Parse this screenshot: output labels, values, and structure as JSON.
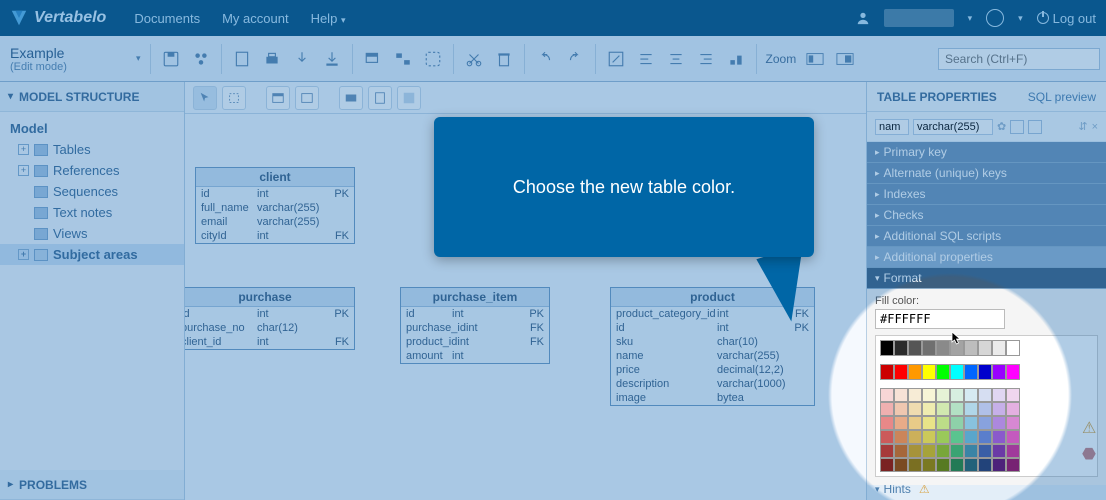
{
  "brand": "Vertabelo",
  "topnav": {
    "documents": "Documents",
    "my_account": "My account",
    "help": "Help",
    "logout": "Log out"
  },
  "doc": {
    "title": "Example",
    "mode": "(Edit mode)"
  },
  "zoom_label": "Zoom",
  "search_placeholder": "Search (Ctrl+F)",
  "leftpanel": {
    "structure_hdr": "MODEL STRUCTURE",
    "root": "Model",
    "items": [
      "Tables",
      "References",
      "Sequences",
      "Text notes",
      "Views",
      "Subject areas"
    ],
    "problems_hdr": "PROBLEMS"
  },
  "tables": {
    "client": {
      "name": "client",
      "cols": [
        {
          "n": "id",
          "t": "int",
          "k": "PK"
        },
        {
          "n": "full_name",
          "t": "varchar(255)",
          "k": ""
        },
        {
          "n": "email",
          "t": "varchar(255)",
          "k": ""
        },
        {
          "n": "cityId",
          "t": "int",
          "k": "FK"
        }
      ]
    },
    "purchase": {
      "name": "purchase",
      "cols": [
        {
          "n": "id",
          "t": "int",
          "k": "PK"
        },
        {
          "n": "purchase_no",
          "t": "char(12)",
          "k": ""
        },
        {
          "n": "client_id",
          "t": "int",
          "k": "FK"
        }
      ]
    },
    "purchase_item": {
      "name": "purchase_item",
      "cols": [
        {
          "n": "id",
          "t": "int",
          "k": "PK"
        },
        {
          "n": "purchase_id",
          "t": "int",
          "k": "FK"
        },
        {
          "n": "product_id",
          "t": "int",
          "k": "FK"
        },
        {
          "n": "amount",
          "t": "int",
          "k": ""
        }
      ]
    },
    "product": {
      "name": "product",
      "cols": [
        {
          "n": "product_category_id",
          "t": "int",
          "k": "FK"
        },
        {
          "n": "id",
          "t": "int",
          "k": "PK"
        },
        {
          "n": "sku",
          "t": "char(10)",
          "k": ""
        },
        {
          "n": "name",
          "t": "varchar(255)",
          "k": ""
        },
        {
          "n": "price",
          "t": "decimal(12,2)",
          "k": ""
        },
        {
          "n": "description",
          "t": "varchar(1000)",
          "k": ""
        },
        {
          "n": "image",
          "t": "bytea",
          "k": ""
        }
      ]
    }
  },
  "rightpanel": {
    "hdr": "TABLE PROPERTIES",
    "sql": "SQL preview",
    "col_name": "nam",
    "col_type": "varchar(255)",
    "sections": {
      "pk": "Primary key",
      "alt": "Alternate (unique) keys",
      "idx": "Indexes",
      "chk": "Checks",
      "sql": "Additional SQL scripts",
      "props": "Additional properties",
      "fmt": "Format"
    },
    "fill_label": "Fill color:",
    "fill_value": "#FFFFFF",
    "hints": "Hints"
  },
  "bubble_text": "Choose the new table color.",
  "palette": {
    "grays": [
      "#000000",
      "#2b2b2b",
      "#555555",
      "#707070",
      "#8a8a8a",
      "#a3a3a3",
      "#bdbdbd",
      "#d6d6d6",
      "#ebebeb",
      "#ffffff"
    ],
    "primaries": [
      "#cc0000",
      "#ff0000",
      "#ff9900",
      "#ffff00",
      "#00ff00",
      "#00ffff",
      "#0066ff",
      "#0000cc",
      "#9900ff",
      "#ff00ff"
    ],
    "tints": [
      [
        "#f7d6d6",
        "#f7e2d6",
        "#f7ecd6",
        "#f7f5d6",
        "#e6f3d6",
        "#d7efe0",
        "#d6eaf2",
        "#d6def2",
        "#e0d6f2",
        "#f0d6ef"
      ],
      [
        "#efb0b0",
        "#efc7b0",
        "#efdcb0",
        "#efecb0",
        "#d1e8b0",
        "#b3e0c4",
        "#b0d6e8",
        "#b0c0e8",
        "#c6b0e8",
        "#e4b0e1"
      ],
      [
        "#e88888",
        "#e8ab88",
        "#e8cb88",
        "#e8e388",
        "#bcdd88",
        "#8ed1a9",
        "#88c2de",
        "#88a2de",
        "#ac88de",
        "#d788d3"
      ],
      [
        "#cc5a5a",
        "#cc855a",
        "#ccb05a",
        "#ccc95a",
        "#9ac95a",
        "#5ac48f",
        "#5aa6cc",
        "#5a7ecc",
        "#8a5acc",
        "#c45abe"
      ],
      [
        "#a63a3a",
        "#a6673a",
        "#a6933a",
        "#a6a33a",
        "#78a63a",
        "#3aa373",
        "#3a84a6",
        "#3a5ea6",
        "#6b3aa6",
        "#a03a9b"
      ],
      [
        "#7a2222",
        "#7a4a22",
        "#7a6f22",
        "#7a7922",
        "#577a22",
        "#227a56",
        "#22617a",
        "#22437a",
        "#4d227a",
        "#772273"
      ]
    ]
  }
}
